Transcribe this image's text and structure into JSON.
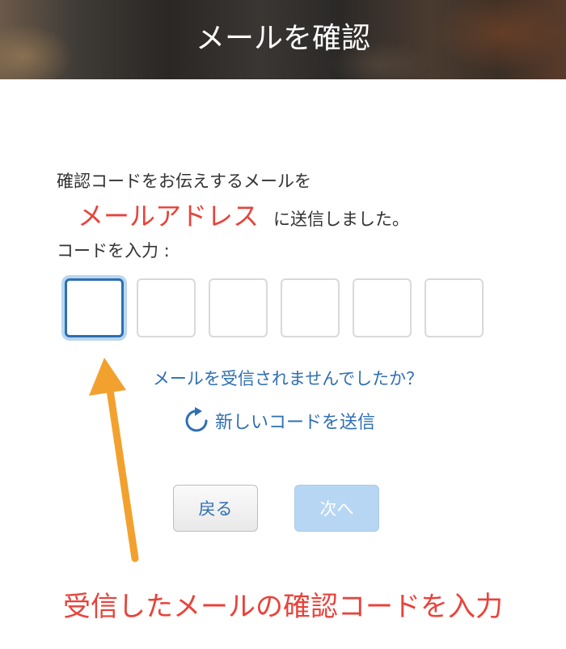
{
  "header": {
    "title": "メールを確認"
  },
  "message": {
    "line1": "確認コードをお伝えするメールを",
    "email": "メールアドレス",
    "sent_suffix": "に送信しました。",
    "code_label": "コードを入力 :"
  },
  "code_input": {
    "box_count": 6,
    "values": [
      "",
      "",
      "",
      "",
      "",
      ""
    ],
    "active_index": 0
  },
  "links": {
    "not_received": "メールを受信されませんでしたか？",
    "resend": "新しいコードを送信"
  },
  "buttons": {
    "back": "戻る",
    "next": "次へ"
  },
  "annotation": {
    "caption": "受信したメールの確認コードを入力"
  },
  "colors": {
    "accent_blue": "#2f6fb3",
    "highlight_red": "#e8433a",
    "arrow_orange": "#f2a12e",
    "next_disabled": "#b7d6f3"
  },
  "icons": {
    "resend": "refresh-icon",
    "arrow": "arrow-up-icon"
  }
}
